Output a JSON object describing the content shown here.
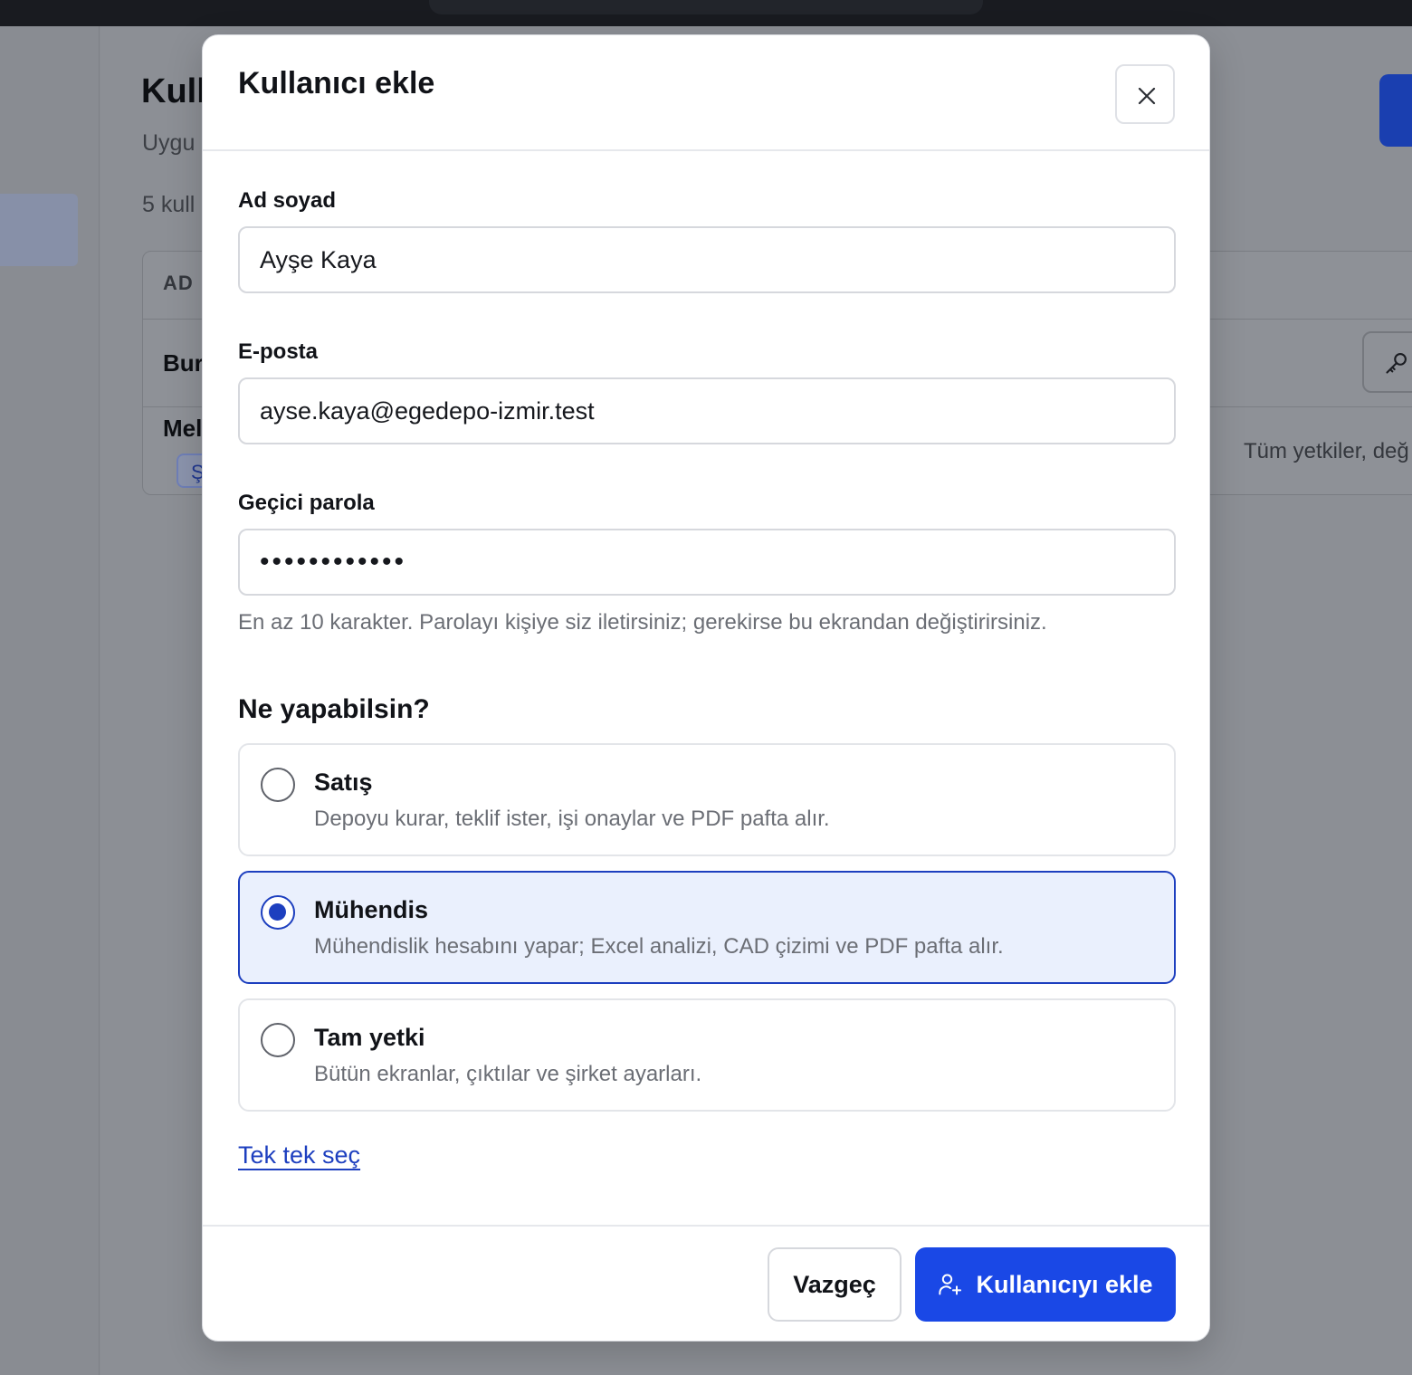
{
  "background": {
    "page_title": "Kull",
    "page_subtitle": "Uygu",
    "user_count": "5 kull",
    "table_header": "AD",
    "row1_name": "Bur",
    "row2_name": "Mel",
    "row2_chip": "Ş",
    "row2_permissions": "Tüm yetkiler, değ"
  },
  "modal": {
    "title": "Kullanıcı ekle",
    "close_label": "×",
    "fields": {
      "name": {
        "label": "Ad soyad",
        "value": "Ayşe Kaya"
      },
      "email": {
        "label": "E-posta",
        "value": "ayse.kaya@egedepo-izmir.test"
      },
      "password": {
        "label": "Geçici parola",
        "value": "••••••••••••",
        "hint": "En az 10 karakter. Parolayı kişiye siz iletirsiniz; gerekirse bu ekrandan değiştirirsiniz."
      }
    },
    "roles_title": "Ne yapabilsin?",
    "roles": [
      {
        "name": "Satış",
        "description": "Depoyu kurar, teklif ister, işi onaylar ve PDF pafta alır.",
        "selected": false
      },
      {
        "name": "Mühendis",
        "description": "Mühendislik hesabını yapar; Excel analizi, CAD çizimi ve PDF pafta alır.",
        "selected": true
      },
      {
        "name": "Tam yetki",
        "description": "Bütün ekranlar, çıktılar ve şirket ayarları.",
        "selected": false
      }
    ],
    "custom_link": "Tek tek seç",
    "cancel_label": "Vazgeç",
    "submit_label": "Kullanıcıyı ekle",
    "submit_icon": "user-plus-icon"
  },
  "colors": {
    "accent": "#1a48e6",
    "selected_border": "#1d3fbf",
    "selected_bg": "#eaf0fd"
  }
}
